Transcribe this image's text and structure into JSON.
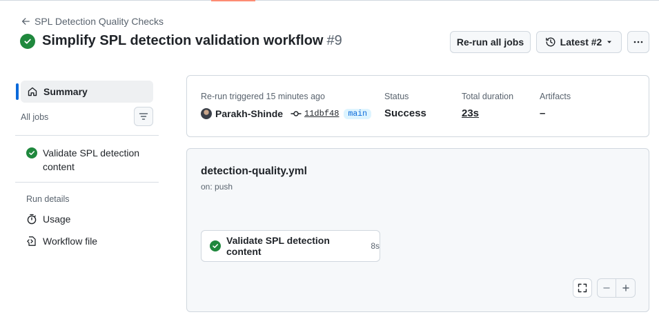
{
  "header": {
    "back_label": "SPL Detection Quality Checks",
    "title": "Simplify SPL detection validation workflow",
    "run_number": "#9",
    "rerun_button": "Re-run all jobs",
    "attempt_selector": "Latest #2"
  },
  "sidebar": {
    "summary_label": "Summary",
    "all_jobs_label": "All jobs",
    "jobs": [
      {
        "label": "Validate SPL detection content",
        "status": "success"
      }
    ],
    "run_details_label": "Run details",
    "usage_label": "Usage",
    "workflow_file_label": "Workflow file"
  },
  "summary": {
    "trigger_label": "Re-run triggered 15 minutes ago",
    "actor": "Parakh-Shinde",
    "commit_sha": "11dbf48",
    "branch": "main",
    "status_label": "Status",
    "status_value": "Success",
    "duration_label": "Total duration",
    "duration_value": "23s",
    "artifacts_label": "Artifacts",
    "artifacts_value": "–"
  },
  "workflow": {
    "file_name": "detection-quality.yml",
    "trigger": "on: push",
    "job_name": "Validate SPL detection content",
    "job_duration": "8s"
  },
  "colors": {
    "success": "#1f883d",
    "link": "#0969da",
    "accent": "#fd8c73"
  }
}
